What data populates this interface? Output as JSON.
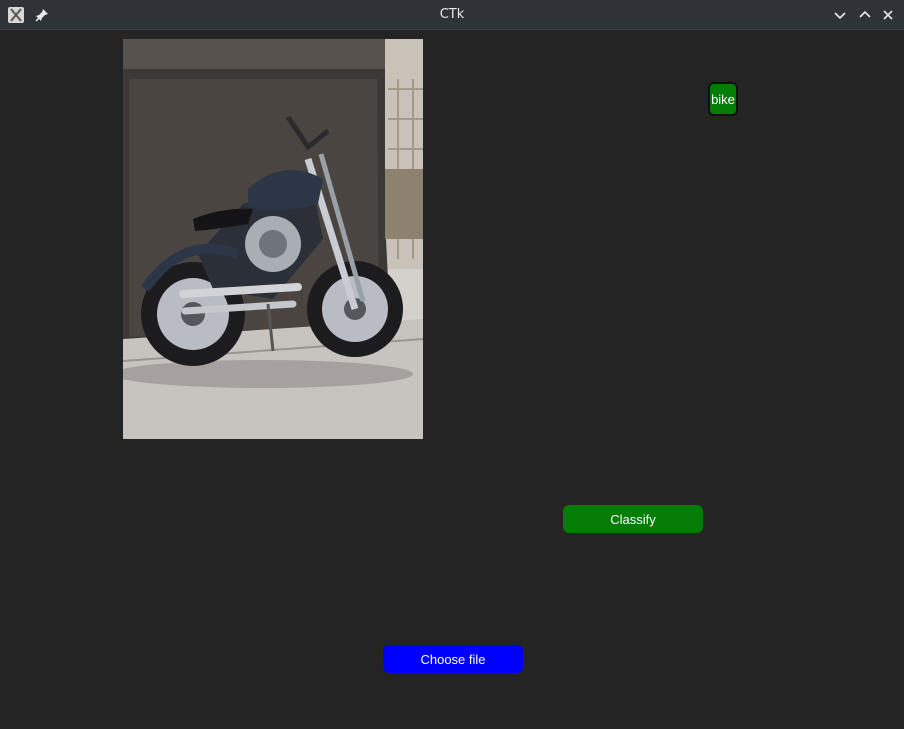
{
  "window": {
    "title": "CTk",
    "icons": [
      "app-icon",
      "pin-icon",
      "minimize-icon",
      "maximize-icon",
      "close-icon"
    ]
  },
  "main": {
    "image_subject": "motorcycle",
    "result_label": "bike",
    "classify_label": "Classify",
    "choose_file_label": "Choose file"
  },
  "colors": {
    "background": "#242424",
    "titlebar": "#2f3237",
    "classify_button": "#047c05",
    "result_label_bg": "#047c05",
    "choose_file_button": "#0000ff"
  }
}
